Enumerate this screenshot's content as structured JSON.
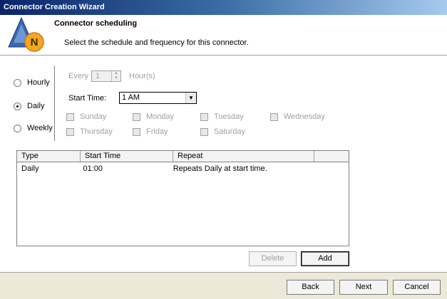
{
  "window": {
    "title": "Connector Creation Wizard"
  },
  "header": {
    "logo_letter": "N",
    "title": "Connector scheduling",
    "subtitle": "Select the schedule and frequency for this connector."
  },
  "frequency": {
    "options": [
      {
        "label": "Hourly",
        "selected": false
      },
      {
        "label": "Daily",
        "selected": true
      },
      {
        "label": "Weekly",
        "selected": false
      }
    ]
  },
  "schedule": {
    "every_label": "Every",
    "every_value": "1",
    "hours_label": "Hour(s)",
    "start_time_label": "Start Time:",
    "start_time_value": "1 AM",
    "days": [
      {
        "label": "Sunday",
        "checked": false
      },
      {
        "label": "Monday",
        "checked": false
      },
      {
        "label": "Tuesday",
        "checked": false
      },
      {
        "label": "Wednesday",
        "checked": false
      },
      {
        "label": "Thursday",
        "checked": false
      },
      {
        "label": "Friday",
        "checked": false
      },
      {
        "label": "Saturday",
        "checked": false
      }
    ]
  },
  "table": {
    "columns": [
      "Type",
      "Start Time",
      "Repeat",
      ""
    ],
    "rows": [
      [
        "Daily",
        "01:00",
        "Repeats Daily at start time."
      ]
    ]
  },
  "actions": {
    "delete_label": "Delete",
    "add_label": "Add"
  },
  "footer": {
    "back_label": "Back",
    "next_label": "Next",
    "cancel_label": "Cancel"
  },
  "colors": {
    "titlebar_start": "#0a246a",
    "logo_orange": "#f5a623",
    "logo_blue": "#2e5fa8"
  }
}
